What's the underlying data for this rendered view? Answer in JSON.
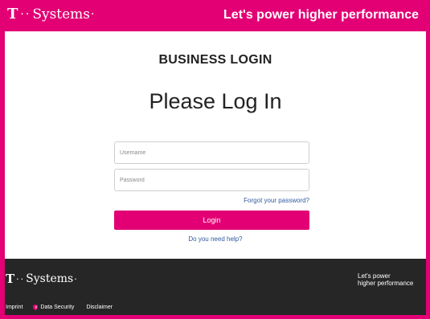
{
  "header": {
    "logo": {
      "t_mark": "T",
      "dots": "··",
      "name": "Systems",
      "trail": "·"
    },
    "tagline": "Let's power higher performance"
  },
  "main": {
    "section_title": "BUSINESS LOGIN",
    "heading": "Please Log In",
    "username": {
      "placeholder": "Username",
      "value": ""
    },
    "password": {
      "placeholder": "Password",
      "value": ""
    },
    "forgot_link": "Forgot your password?",
    "login_button": "Login",
    "help_link": "Do you need help?"
  },
  "footer": {
    "logo": {
      "t_mark": "T",
      "dots": "··",
      "name": "Systems",
      "trail": "·"
    },
    "tagline_line1": "Let's power",
    "tagline_line2": "higher performance",
    "links": {
      "imprint": "Imprint",
      "data_security": "Data Security",
      "disclaimer": "Disclaimer"
    }
  },
  "colors": {
    "brand_magenta": "#e20074",
    "footer_bg": "#262626",
    "link_blue": "#2f5a9c"
  },
  "icons": {
    "data_security": "shield-icon"
  }
}
